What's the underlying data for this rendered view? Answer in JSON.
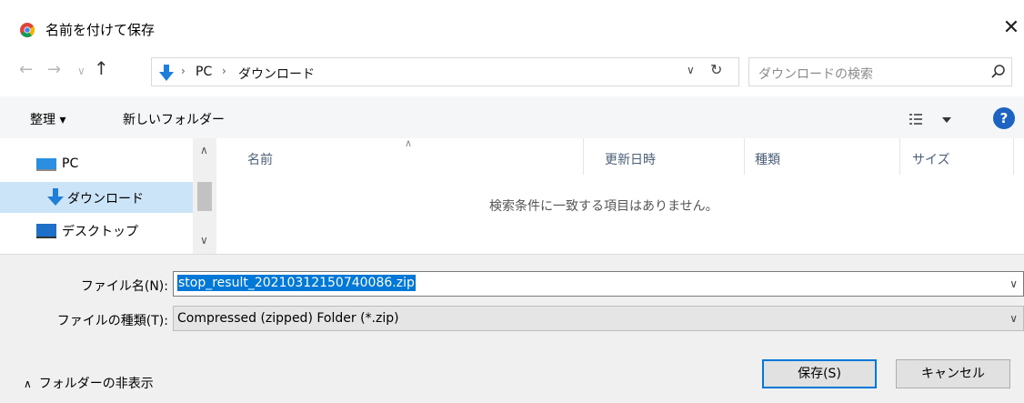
{
  "window": {
    "title": "名前を付けて保存",
    "close_glyph": "✕",
    "accent": "#0078d7"
  },
  "address": {
    "crumbs": [
      "PC",
      "ダウンロード"
    ],
    "separator": "›",
    "search_placeholder": "ダウンロードの検索"
  },
  "toolbar": {
    "organize_label": "整理 ▾",
    "new_folder_label": "新しいフォルダー",
    "help_label": "?"
  },
  "nav_pane": {
    "items": [
      {
        "label": "PC",
        "icon": "pc-icon"
      },
      {
        "label": "ダウンロード",
        "icon": "download-arrow-icon"
      },
      {
        "label": "デスクトップ",
        "icon": "desktop-icon"
      }
    ],
    "selected_index": 1
  },
  "file_list": {
    "columns": [
      "名前",
      "更新日時",
      "種類",
      "サイズ"
    ],
    "empty_message": "検索条件に一致する項目はありません。"
  },
  "form": {
    "filename_label": "ファイル名(N):",
    "filename_value": "stop_result_20210312150740086.zip",
    "filetype_label": "ファイルの種類(T):",
    "filetype_value": "Compressed (zipped) Folder (*.zip)"
  },
  "footer": {
    "hide_folders_label": "フォルダーの非表示",
    "save_label": "保存(S)",
    "cancel_label": "キャンセル"
  }
}
